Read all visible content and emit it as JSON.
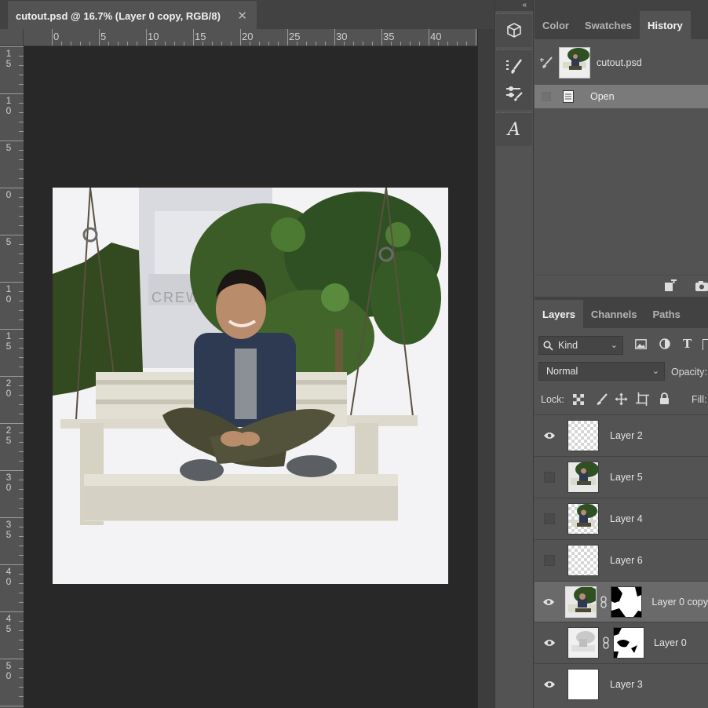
{
  "document": {
    "tab_title": "cutout.psd @ 16.7% (Layer 0 copy, RGB/8)",
    "close_glyph": "✕",
    "h_ruler_labels": [
      "0",
      "5",
      "10",
      "15",
      "20",
      "25",
      "30",
      "35",
      "40"
    ],
    "v_ruler_labels": [
      "1\n5",
      "1\n0",
      "5",
      "0",
      "5",
      "1\n0",
      "1\n5",
      "2\n0",
      "2\n5",
      "3\n0",
      "3\n5",
      "4\n0",
      "4\n5",
      "5\n0"
    ]
  },
  "toolstrip": {
    "collapse_glyph": "«",
    "tools": [
      "3d-cube-icon",
      "brush-presets-icon",
      "brush-settings-icon",
      "glyphs-icon"
    ]
  },
  "top_panel": {
    "tabs": [
      "Color",
      "Swatches",
      "History"
    ],
    "active_tab": "History",
    "history": {
      "snapshot_name": "cutout.psd",
      "states": [
        {
          "label": "Open"
        }
      ]
    }
  },
  "layers_panel": {
    "tabs": [
      "Layers",
      "Channels",
      "Paths"
    ],
    "active_tab": "Layers",
    "filter_kind": "Kind",
    "blend_mode": "Normal",
    "opacity_label": "Opacity:",
    "lock_label": "Lock:",
    "fill_label": "Fill:",
    "layers": [
      {
        "name": "Layer 2",
        "visible": true,
        "thumb": "transparent",
        "mask": false,
        "selected": false
      },
      {
        "name": "Layer 5",
        "visible": false,
        "thumb": "photo",
        "mask": false,
        "selected": false
      },
      {
        "name": "Layer 4",
        "visible": false,
        "thumb": "photo-cutout",
        "mask": false,
        "selected": false
      },
      {
        "name": "Layer 6",
        "visible": false,
        "thumb": "transparent",
        "mask": false,
        "selected": false
      },
      {
        "name": "Layer 0 copy",
        "visible": true,
        "thumb": "photo",
        "mask": true,
        "selected": true
      },
      {
        "name": "Layer 0",
        "visible": true,
        "thumb": "light-photo",
        "mask": true,
        "selected": false
      },
      {
        "name": "Layer 3",
        "visible": true,
        "thumb": "white",
        "mask": false,
        "selected": false
      }
    ]
  },
  "colors": {
    "panel_bg": "#535353",
    "tab_bar_bg": "#424242",
    "canvas_bg": "#282828",
    "selected_row": "#6a6a6a",
    "history_selected": "#7a7a7a"
  }
}
